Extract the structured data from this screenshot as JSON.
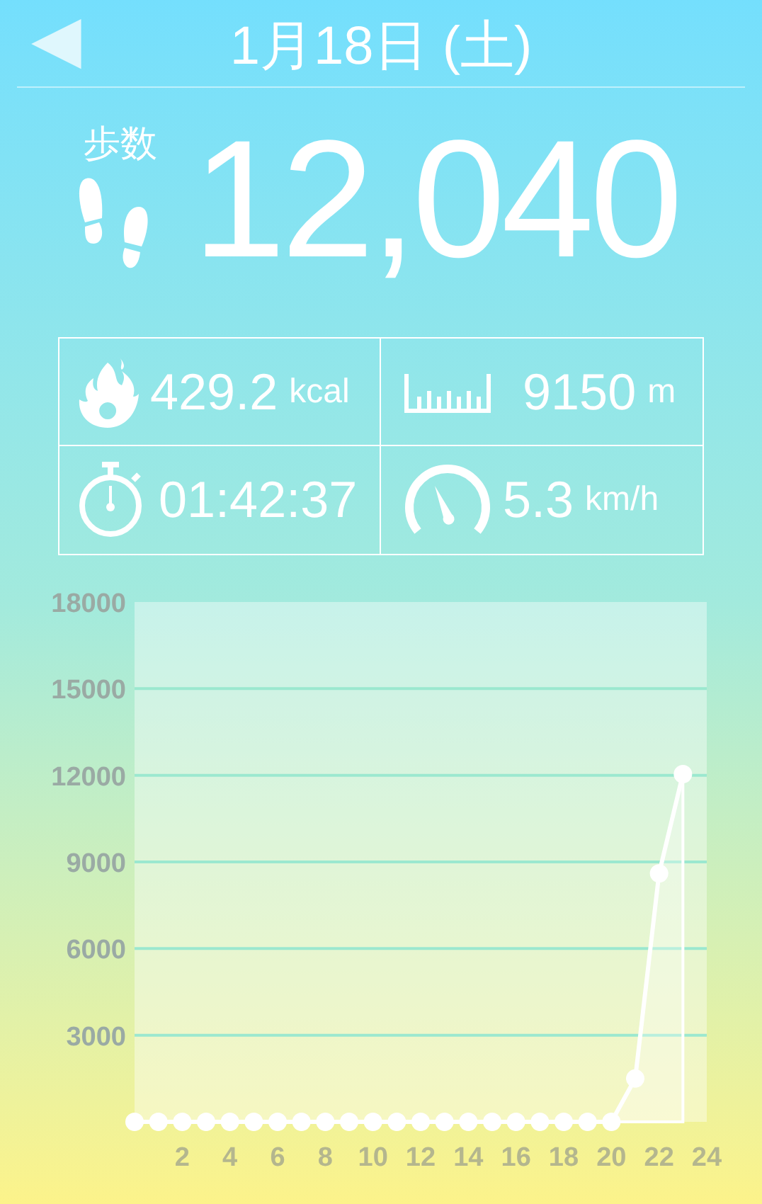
{
  "header": {
    "back": "◀",
    "date": "1月18日 (土)"
  },
  "steps": {
    "label": "歩数",
    "value": "12,040"
  },
  "stats": [
    {
      "kind": "calories",
      "value": "429.2",
      "unit": "kcal"
    },
    {
      "kind": "distance",
      "value": "9150",
      "unit": "m"
    },
    {
      "kind": "time",
      "value": "01:42:37"
    },
    {
      "kind": "speed",
      "value": "5.3",
      "unit": "km/h"
    }
  ],
  "chart": {
    "chart_data": {
      "type": "area",
      "x": [
        0,
        1,
        2,
        3,
        4,
        5,
        6,
        7,
        8,
        9,
        10,
        11,
        12,
        13,
        14,
        15,
        16,
        17,
        18,
        19,
        20,
        21,
        22,
        23
      ],
      "series": [
        {
          "color": "#ffffff",
          "values": [
            0,
            0,
            0,
            0,
            0,
            0,
            0,
            0,
            0,
            0,
            0,
            0,
            0,
            0,
            0,
            0,
            0,
            0,
            0,
            0,
            0,
            1500,
            8600,
            12040
          ]
        }
      ],
      "grid": true,
      "xlim": [
        0,
        24
      ],
      "ylim": [
        0,
        18000
      ],
      "xticks": [
        2,
        4,
        6,
        8,
        10,
        12,
        14,
        16,
        18,
        20,
        22,
        24
      ],
      "yticks": [
        3000,
        6000,
        9000,
        12000,
        15000,
        18000
      ]
    }
  }
}
